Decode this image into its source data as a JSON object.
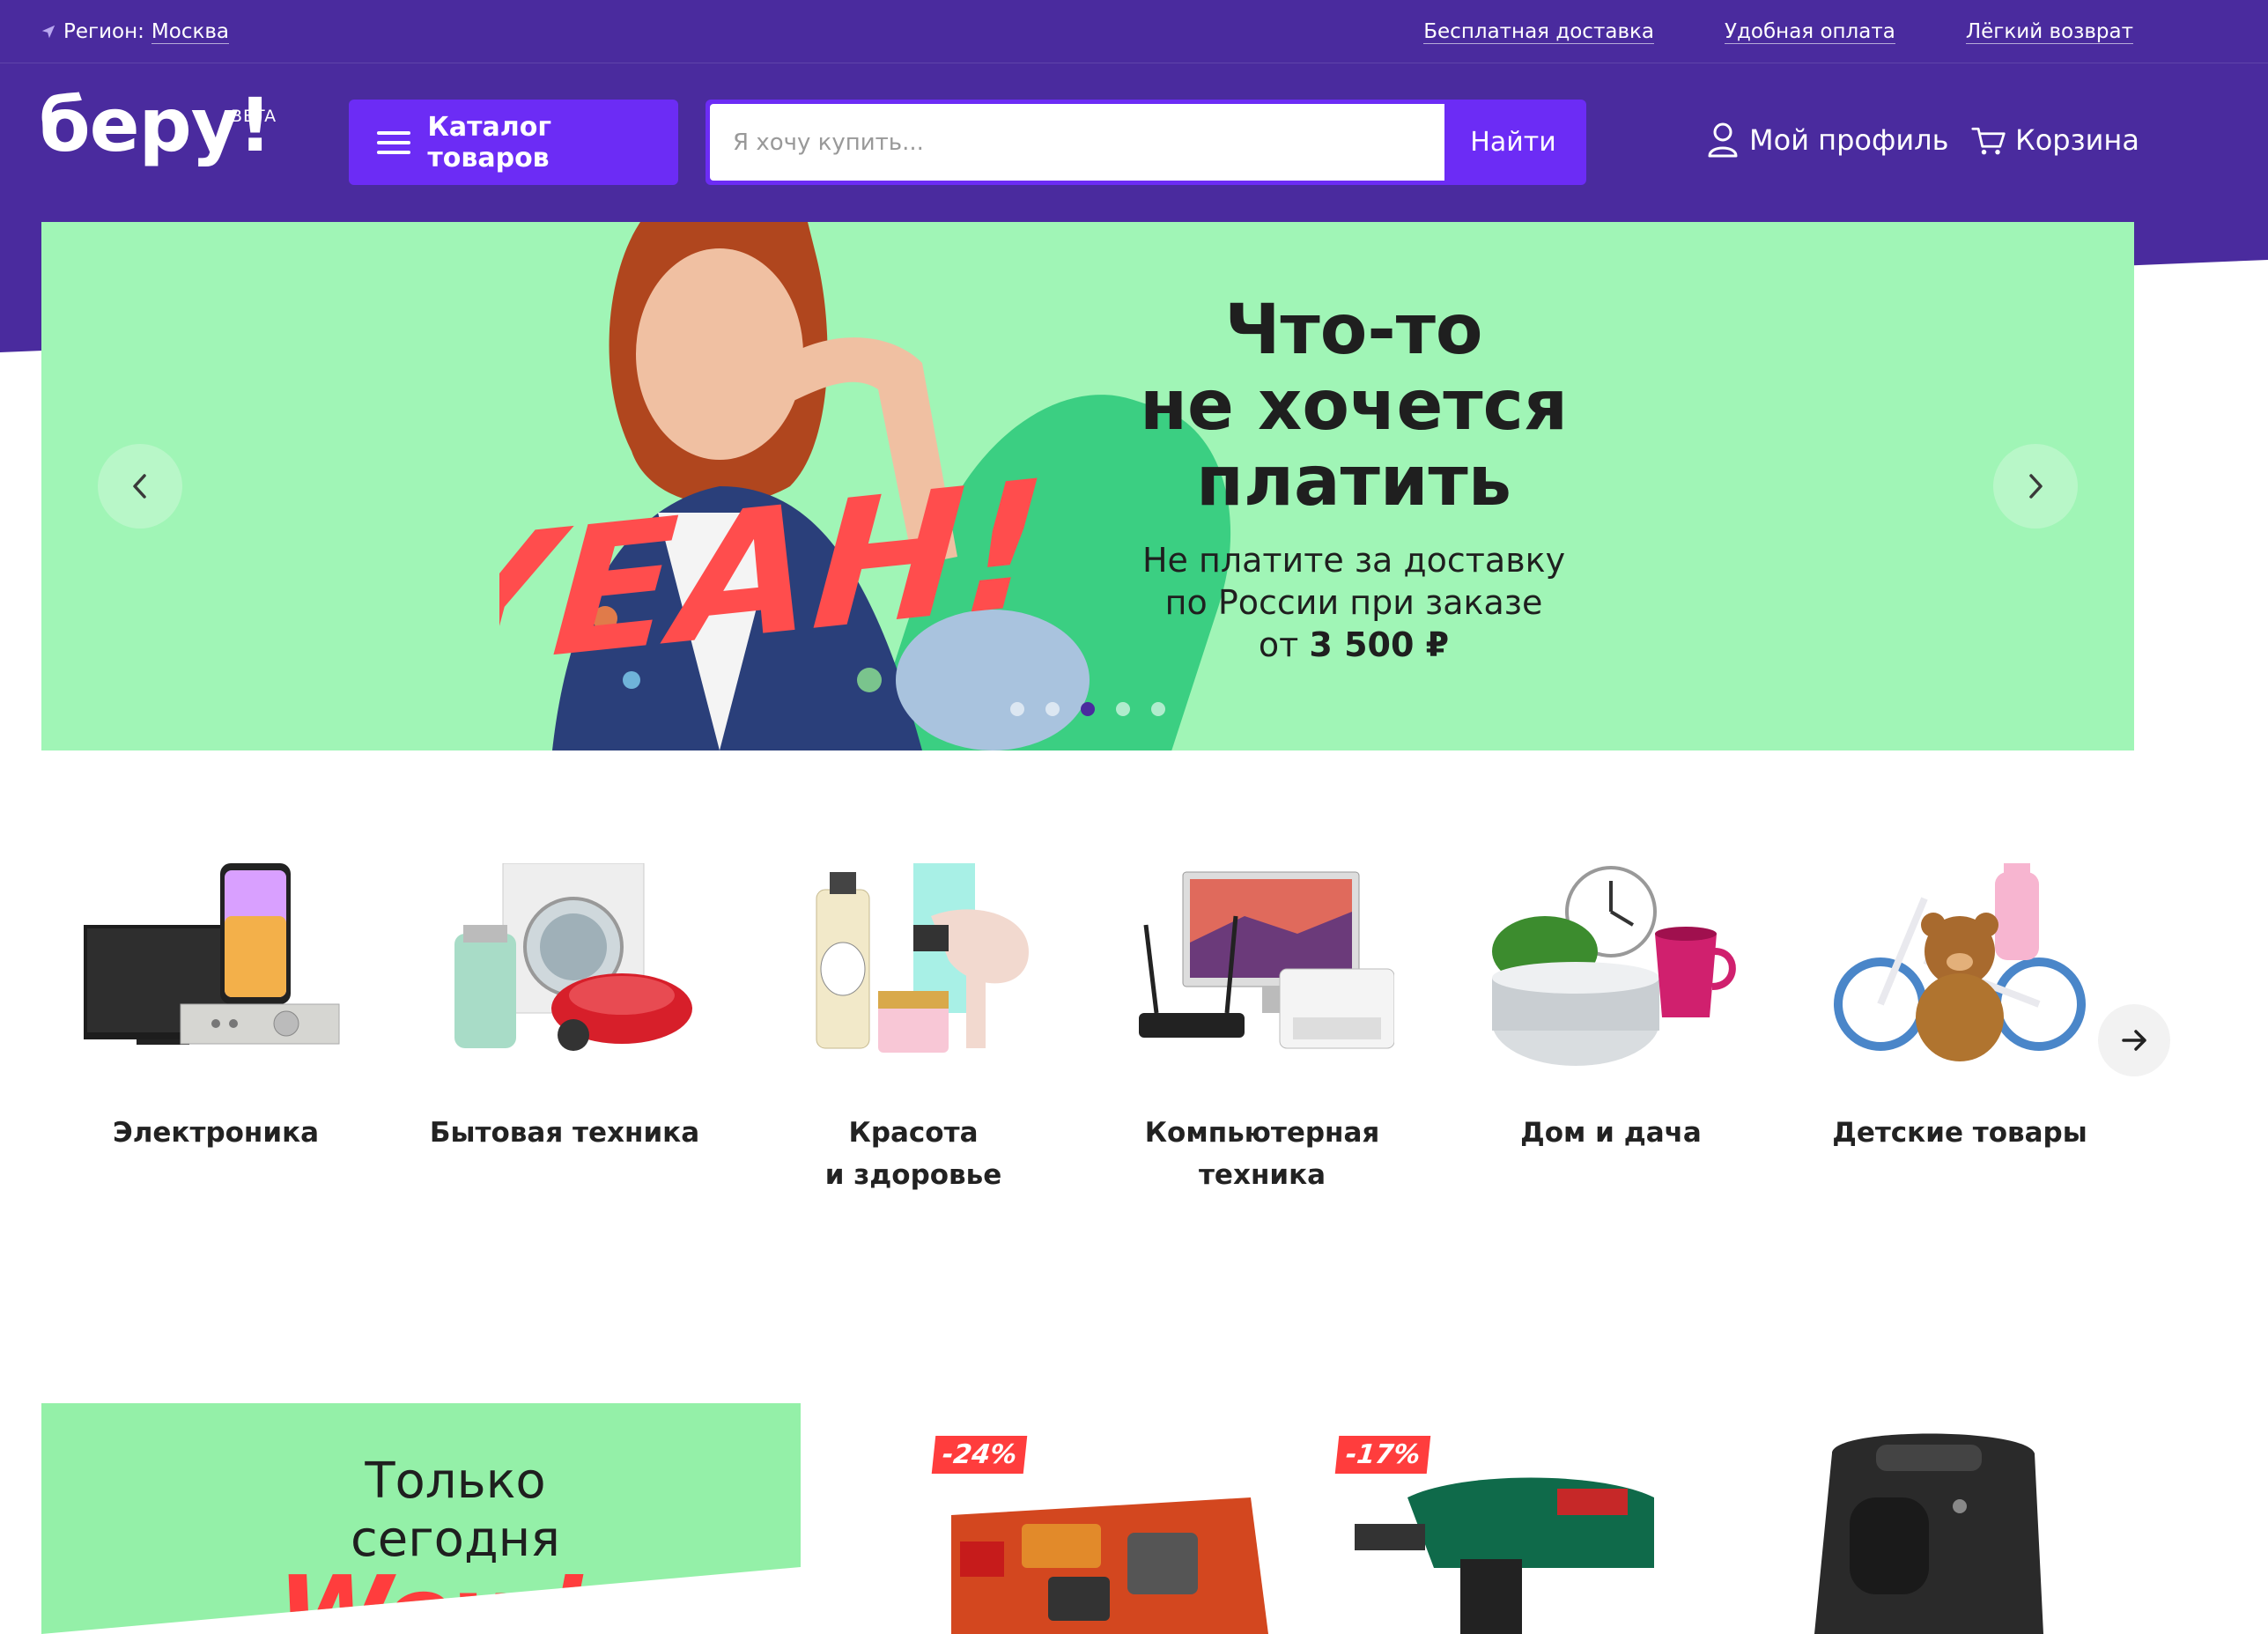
{
  "topbar": {
    "region_prefix": "Регион:",
    "region_city": "Москва",
    "links": [
      "Бесплатная доставка",
      "Удобная оплата",
      "Лёгкий возврат"
    ]
  },
  "header": {
    "logo": "беру!",
    "logo_badge": "BETA",
    "catalog_button": "Каталог товаров",
    "search_placeholder": "Я хочу купить...",
    "search_button": "Найти",
    "profile_label": "Мой профиль",
    "cart_label": "Корзина"
  },
  "hero": {
    "title": "Что-то\nне хочется\nплатить",
    "subtitle": "Не платите за доставку\nпо России при заказе\nот",
    "price": "3 500 ₽",
    "overlay_text": "YEAH!",
    "slides_count": 5,
    "active_slide": 3
  },
  "categories": [
    {
      "label": "Электроника",
      "icon": "electronics-image"
    },
    {
      "label": "Бытовая техника",
      "icon": "appliances-image"
    },
    {
      "label": "Красота\nи здоровье",
      "icon": "beauty-image"
    },
    {
      "label": "Компьютерная\nтехника",
      "icon": "computer-image"
    },
    {
      "label": "Дом и дача",
      "icon": "home-garden-image"
    },
    {
      "label": "Детские товары",
      "icon": "kids-image"
    }
  ],
  "promo": {
    "title": "Только\nсегодня",
    "wow": "Wow!"
  },
  "deals": [
    {
      "discount": "-24%",
      "name": "lego-power-functions"
    },
    {
      "discount": "-17%",
      "name": "bosch-hammer-drill"
    },
    {
      "discount": "",
      "name": "coffee-machine"
    }
  ],
  "colors": {
    "brand_purple": "#4a2b9e",
    "accent_violet": "#6c2cf5",
    "hero_green": "#a0f5b6",
    "sale_red": "#ff3d3d"
  }
}
